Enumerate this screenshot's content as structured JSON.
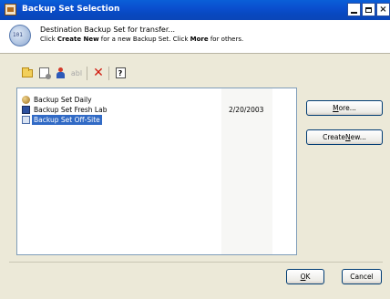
{
  "window": {
    "title": "Backup Set Selection",
    "controls": {
      "minimize": "minimize",
      "maximize": "maximize",
      "close": "×"
    }
  },
  "header": {
    "line1": "Destination Backup Set for transfer...",
    "line2_prefix": "Click ",
    "line2_create": "Create New",
    "line2_middle": " for a new Backup Set. Click ",
    "line2_more": "More",
    "line2_suffix": " for others."
  },
  "toolbar": {
    "buttons": [
      {
        "icon": "new-folder-icon"
      },
      {
        "icon": "properties-icon"
      },
      {
        "icon": "user-icon"
      },
      {
        "icon": "rename-icon",
        "label": "abl"
      },
      {
        "icon": "delete-icon",
        "label": "✕"
      },
      {
        "icon": "help-icon",
        "label": "?"
      }
    ]
  },
  "backup_sets": [
    {
      "name": "Backup Set Daily",
      "date": "",
      "icon": "daily-set-icon",
      "selected": false
    },
    {
      "name": "Backup Set Fresh Lab",
      "date": "2/20/2003",
      "icon": "fresh-set-icon",
      "selected": false
    },
    {
      "name": "Backup Set Off-Site",
      "date": "",
      "icon": "offsite-set-icon",
      "selected": true
    }
  ],
  "buttons": {
    "more_mnemonic": "M",
    "more_rest": "ore...",
    "create_prefix": "Create ",
    "create_mnemonic": "N",
    "create_rest": "ew...",
    "ok_mnemonic": "O",
    "ok_rest": "K",
    "cancel": "Cancel"
  },
  "colors": {
    "titlebar": "#0a4fcf",
    "selection": "#316ac5",
    "delete": "#d11c10",
    "dialog_bg": "#ECE9D8"
  }
}
